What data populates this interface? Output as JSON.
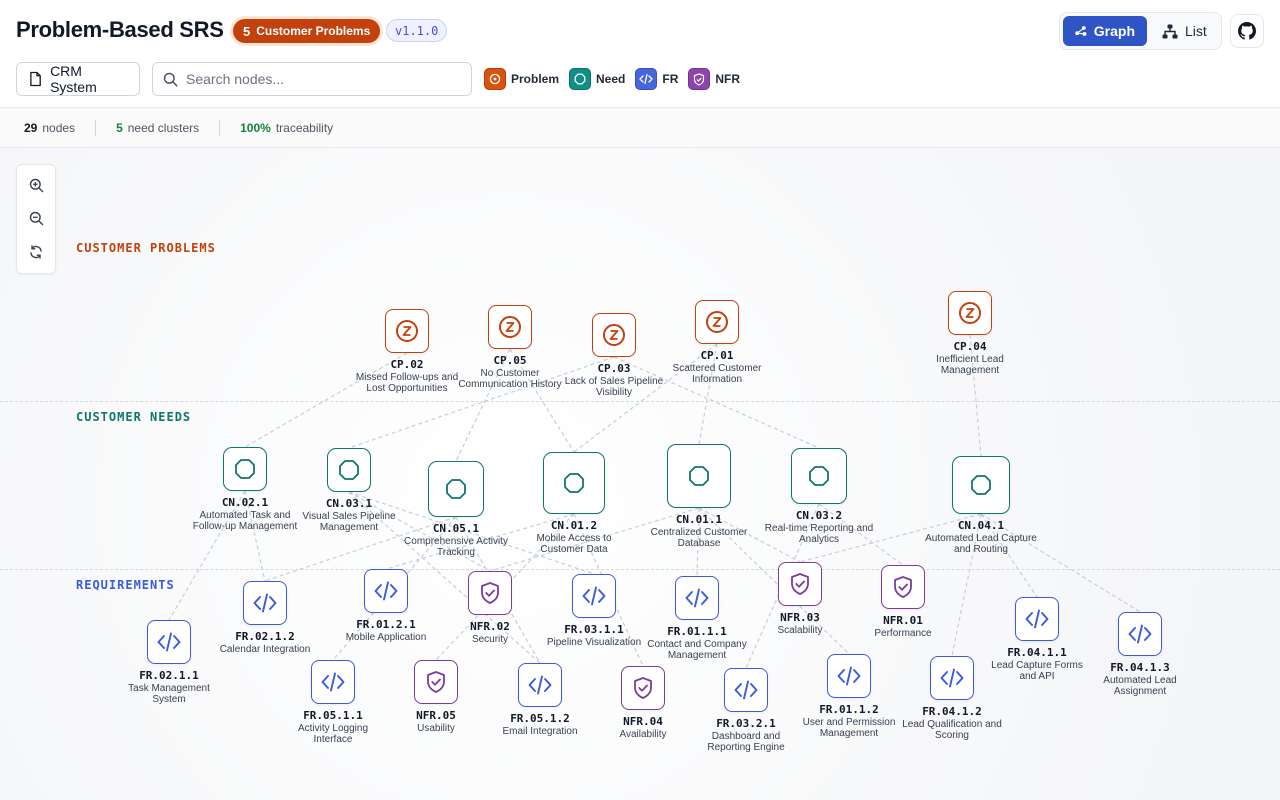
{
  "header": {
    "title": "Problem-Based SRS",
    "cp_badge_count": "5",
    "cp_badge_label": "Customer Problems",
    "version": "v1.1.0",
    "view_graph": "Graph",
    "view_list": "List",
    "active_view": "Graph"
  },
  "toolbar": {
    "system_label": "CRM System",
    "search_placeholder": "Search nodes...",
    "search_value": ""
  },
  "legend": [
    {
      "key": "problem",
      "label": "Problem",
      "color": "#c2410c"
    },
    {
      "key": "need",
      "label": "Need",
      "color": "#0f766e"
    },
    {
      "key": "fr",
      "label": "FR",
      "color": "#3b5bdb"
    },
    {
      "key": "nfr",
      "label": "NFR",
      "color": "#7e3a9c"
    }
  ],
  "stats": {
    "nodes_num": "29",
    "nodes_label": "nodes",
    "clusters_num": "5",
    "clusters_label": "need clusters",
    "trace_num": "100%",
    "trace_label": "traceability"
  },
  "sections": {
    "problems": "CUSTOMER PROBLEMS",
    "needs": "CUSTOMER NEEDS",
    "requirements": "REQUIREMENTS"
  },
  "colors": {
    "problem": "#c2410c",
    "need": "#0f766e",
    "fr": "#3b5bdb",
    "nfr": "#7e3a9c"
  },
  "nodes": [
    {
      "id": "CP.02",
      "type": "problem",
      "title": "Missed Follow-ups and Lost Opportunities"
    },
    {
      "id": "CP.05",
      "type": "problem",
      "title": "No Customer Communication History"
    },
    {
      "id": "CP.03",
      "type": "problem",
      "title": "Lack of Sales Pipeline Visibility"
    },
    {
      "id": "CP.01",
      "type": "problem",
      "title": "Scattered Customer Information"
    },
    {
      "id": "CP.04",
      "type": "problem",
      "title": "Inefficient Lead Management"
    },
    {
      "id": "CN.02.1",
      "type": "need",
      "title": "Automated Task and Follow-up Management"
    },
    {
      "id": "CN.03.1",
      "type": "need",
      "title": "Visual Sales Pipeline Management"
    },
    {
      "id": "CN.05.1",
      "type": "need",
      "title": "Comprehensive Activity Tracking"
    },
    {
      "id": "CN.01.2",
      "type": "need",
      "title": "Mobile Access to Customer Data"
    },
    {
      "id": "CN.01.1",
      "type": "need",
      "title": "Centralized Customer Database"
    },
    {
      "id": "CN.03.2",
      "type": "need",
      "title": "Real-time Reporting and Analytics"
    },
    {
      "id": "CN.04.1",
      "type": "need",
      "title": "Automated Lead Capture and Routing"
    },
    {
      "id": "FR.02.1.1",
      "type": "fr",
      "title": "Task Management System"
    },
    {
      "id": "FR.02.1.2",
      "type": "fr",
      "title": "Calendar Integration"
    },
    {
      "id": "FR.05.1.1",
      "type": "fr",
      "title": "Activity Logging Interface"
    },
    {
      "id": "FR.01.2.1",
      "type": "fr",
      "title": "Mobile Application"
    },
    {
      "id": "NFR.05",
      "type": "nfr",
      "title": "Usability"
    },
    {
      "id": "NFR.02",
      "type": "nfr",
      "title": "Security"
    },
    {
      "id": "FR.05.1.2",
      "type": "fr",
      "title": "Email Integration"
    },
    {
      "id": "FR.03.1.1",
      "type": "fr",
      "title": "Pipeline Visualization"
    },
    {
      "id": "NFR.04",
      "type": "nfr",
      "title": "Availability"
    },
    {
      "id": "FR.01.1.1",
      "type": "fr",
      "title": "Contact and Company Management"
    },
    {
      "id": "FR.03.2.1",
      "type": "fr",
      "title": "Dashboard and Reporting Engine"
    },
    {
      "id": "NFR.03",
      "type": "nfr",
      "title": "Scalability"
    },
    {
      "id": "FR.01.1.2",
      "type": "fr",
      "title": "User and Permission Management"
    },
    {
      "id": "NFR.01",
      "type": "nfr",
      "title": "Performance"
    },
    {
      "id": "FR.04.1.2",
      "type": "fr",
      "title": "Lead Qualification and Scoring"
    },
    {
      "id": "FR.04.1.1",
      "type": "fr",
      "title": "Lead Capture Forms and API"
    },
    {
      "id": "FR.04.1.3",
      "type": "fr",
      "title": "Automated Lead Assignment"
    }
  ],
  "edges": [
    [
      "CP.01",
      "CN.01.1"
    ],
    [
      "CP.01",
      "CN.01.2"
    ],
    [
      "CP.02",
      "CN.02.1"
    ],
    [
      "CP.03",
      "CN.03.1"
    ],
    [
      "CP.03",
      "CN.03.2"
    ],
    [
      "CP.05",
      "CN.05.1"
    ],
    [
      "CP.05",
      "CN.01.2"
    ],
    [
      "CP.04",
      "CN.04.1"
    ],
    [
      "CN.02.1",
      "FR.02.1.1"
    ],
    [
      "CN.02.1",
      "FR.02.1.2"
    ],
    [
      "CN.03.1",
      "FR.03.1.1"
    ],
    [
      "CN.03.1",
      "NFR.02"
    ],
    [
      "CN.05.1",
      "FR.05.1.1"
    ],
    [
      "CN.05.1",
      "FR.05.1.2"
    ],
    [
      "CN.05.1",
      "FR.02.1.2"
    ],
    [
      "CN.01.2",
      "FR.01.2.1"
    ],
    [
      "CN.01.2",
      "NFR.05"
    ],
    [
      "CN.01.2",
      "NFR.04"
    ],
    [
      "CN.01.1",
      "FR.01.1.1"
    ],
    [
      "CN.01.1",
      "FR.01.1.2"
    ],
    [
      "CN.01.1",
      "NFR.03"
    ],
    [
      "CN.01.1",
      "NFR.02"
    ],
    [
      "CN.03.2",
      "FR.03.2.1"
    ],
    [
      "CN.03.2",
      "NFR.01"
    ],
    [
      "CN.04.1",
      "FR.04.1.1"
    ],
    [
      "CN.04.1",
      "FR.04.1.2"
    ],
    [
      "CN.04.1",
      "FR.04.1.3"
    ],
    [
      "CN.04.1",
      "NFR.03"
    ],
    [
      "CN.03.1",
      "FR.05.1.2"
    ]
  ]
}
